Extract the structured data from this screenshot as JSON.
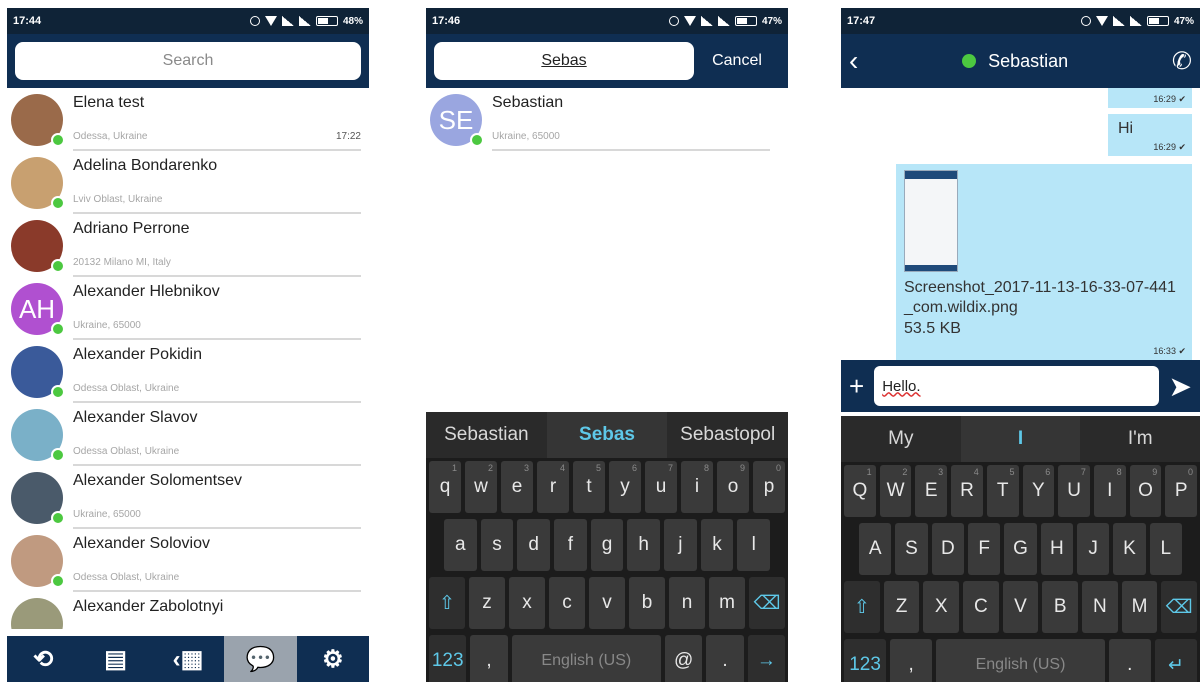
{
  "panel1": {
    "status": {
      "time": "17:44",
      "battery": "48%"
    },
    "search_placeholder": "Search",
    "contacts": [
      {
        "name": "Elena test",
        "location": "Odessa, Ukraine",
        "time": "17:22",
        "avatar_color": "#9a6a4a",
        "initials": ""
      },
      {
        "name": "Adelina Bondarenko",
        "location": "Lviv Oblast, Ukraine",
        "time": "",
        "avatar_color": "#c8a070",
        "initials": ""
      },
      {
        "name": "Adriano Perrone",
        "location": "20132 Milano MI, Italy",
        "time": "",
        "avatar_color": "#8a3a2a",
        "initials": ""
      },
      {
        "name": "Alexander Hlebnikov",
        "location": "Ukraine, 65000",
        "time": "",
        "avatar_color": "#b050d0",
        "initials": "AH"
      },
      {
        "name": "Alexander Pokidin",
        "location": "Odessa Oblast, Ukraine",
        "time": "",
        "avatar_color": "#3a5a9a",
        "initials": ""
      },
      {
        "name": "Alexander Slavov",
        "location": "Odessa Oblast, Ukraine",
        "time": "",
        "avatar_color": "#7ab0c8",
        "initials": ""
      },
      {
        "name": "Alexander Solomentsev",
        "location": "Ukraine, 65000",
        "time": "",
        "avatar_color": "#4a5a6a",
        "initials": ""
      },
      {
        "name": "Alexander Soloviov",
        "location": "Odessa Oblast, Ukraine",
        "time": "",
        "avatar_color": "#c09a80",
        "initials": ""
      },
      {
        "name": "Alexander Zabolotnyi",
        "location": "",
        "time": "",
        "avatar_color": "#9a9a7a",
        "initials": ""
      }
    ],
    "tabs": [
      {
        "icon": "history-icon",
        "glyph": "⟲"
      },
      {
        "icon": "phonebook-icon",
        "glyph": "▤"
      },
      {
        "icon": "dialpad-icon",
        "glyph": "‹▦"
      },
      {
        "icon": "chat-icon",
        "glyph": "💬"
      },
      {
        "icon": "settings-icon",
        "glyph": "⚙"
      }
    ]
  },
  "panel2": {
    "status": {
      "time": "17:46",
      "battery": "47%"
    },
    "search_value": "Sebas",
    "cancel_label": "Cancel",
    "result": {
      "name": "Sebastian",
      "location": "Ukraine, 65000",
      "initials": "SE",
      "avatar_color": "#9aa6e0"
    },
    "keyboard": {
      "suggestions": [
        "Sebastian",
        "Sebas",
        "Sebastopol"
      ],
      "row1": [
        "q",
        "w",
        "e",
        "r",
        "t",
        "y",
        "u",
        "i",
        "o",
        "p"
      ],
      "row1_sup": [
        "1",
        "2",
        "3",
        "4",
        "5",
        "6",
        "7",
        "8",
        "9",
        "0"
      ],
      "row2": [
        "a",
        "s",
        "d",
        "f",
        "g",
        "h",
        "j",
        "k",
        "l"
      ],
      "row3": [
        "z",
        "x",
        "c",
        "v",
        "b",
        "n",
        "m"
      ],
      "num_label": "123",
      "comma": ",",
      "space_label": "English (US)",
      "at": "@",
      "period": ".",
      "enter": "→"
    }
  },
  "panel3": {
    "status": {
      "time": "17:47",
      "battery": "47%"
    },
    "contact_name": "Sebastian",
    "messages": [
      {
        "text": "",
        "time": "16:29"
      },
      {
        "text": "Hi",
        "time": "16:29"
      },
      {
        "file_name": "Screenshot_2017-11-13-16-33-07-441_com.wildix.png",
        "file_size": "53.5 KB",
        "time": "16:33"
      }
    ],
    "compose_value": "Hello.",
    "keyboard": {
      "suggestions": [
        "My",
        "I",
        "I'm"
      ],
      "row1": [
        "Q",
        "W",
        "E",
        "R",
        "T",
        "Y",
        "U",
        "I",
        "O",
        "P"
      ],
      "row1_sup": [
        "1",
        "2",
        "3",
        "4",
        "5",
        "6",
        "7",
        "8",
        "9",
        "0"
      ],
      "row2": [
        "A",
        "S",
        "D",
        "F",
        "G",
        "H",
        "J",
        "K",
        "L"
      ],
      "row3": [
        "Z",
        "X",
        "C",
        "V",
        "B",
        "N",
        "M"
      ],
      "num_label": "123",
      "comma": ",",
      "space_label": "English (US)",
      "period": ".",
      "enter": "↵"
    }
  }
}
